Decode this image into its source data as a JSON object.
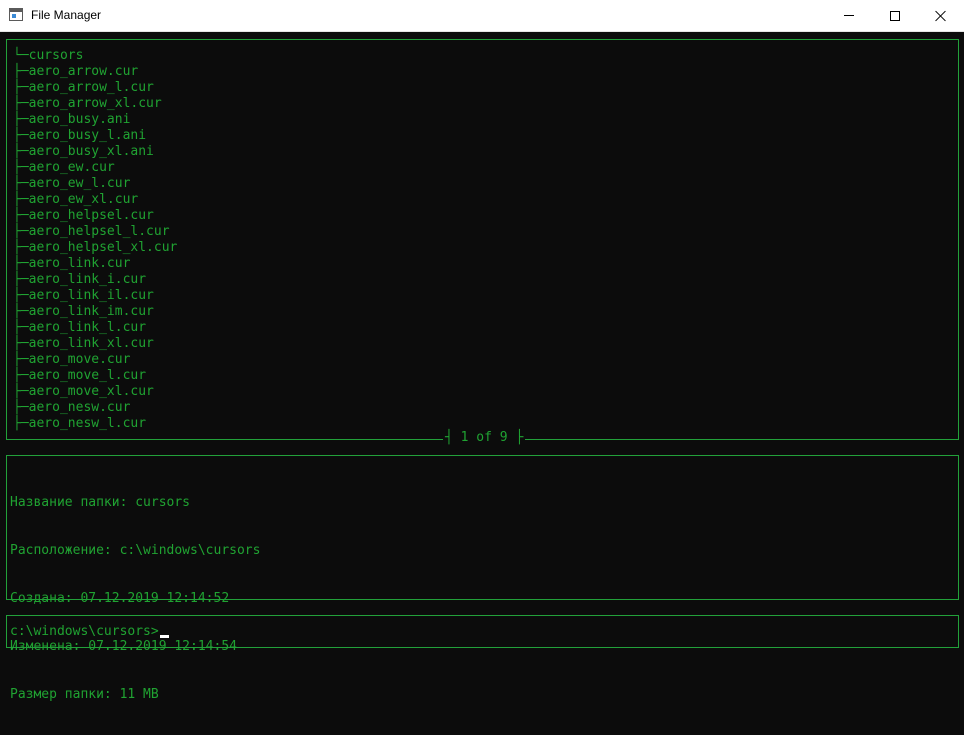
{
  "window": {
    "title": "File Manager",
    "icon": "app-window-icon",
    "controls": {
      "minimize": "minimize-icon",
      "maximize": "maximize-icon",
      "close": "close-icon"
    }
  },
  "colors": {
    "accent": "#20a332",
    "background": "#0c0c0c",
    "titlebar": "#ffffff"
  },
  "tree": {
    "root": "└─cursors",
    "items": [
      "├─aero_arrow.cur",
      "├─aero_arrow_l.cur",
      "├─aero_arrow_xl.cur",
      "├─aero_busy.ani",
      "├─aero_busy_l.ani",
      "├─aero_busy_xl.ani",
      "├─aero_ew.cur",
      "├─aero_ew_l.cur",
      "├─aero_ew_xl.cur",
      "├─aero_helpsel.cur",
      "├─aero_helpsel_l.cur",
      "├─aero_helpsel_xl.cur",
      "├─aero_link.cur",
      "├─aero_link_i.cur",
      "├─aero_link_il.cur",
      "├─aero_link_im.cur",
      "├─aero_link_l.cur",
      "├─aero_link_xl.cur",
      "├─aero_move.cur",
      "├─aero_move_l.cur",
      "├─aero_move_xl.cur",
      "├─aero_nesw.cur",
      "├─aero_nesw_l.cur"
    ],
    "pager": "┤ 1 of 9 ├"
  },
  "info": {
    "name": "Название папки: cursors",
    "location": "Расположение: c:\\windows\\cursors",
    "created": "Создана: 07.12.2019 12:14:52",
    "modified": "Изменена: 07.12.2019 12:14:54",
    "size": "Размер папки: 11 MB"
  },
  "command": {
    "prompt": "c:\\windows\\cursors>"
  }
}
